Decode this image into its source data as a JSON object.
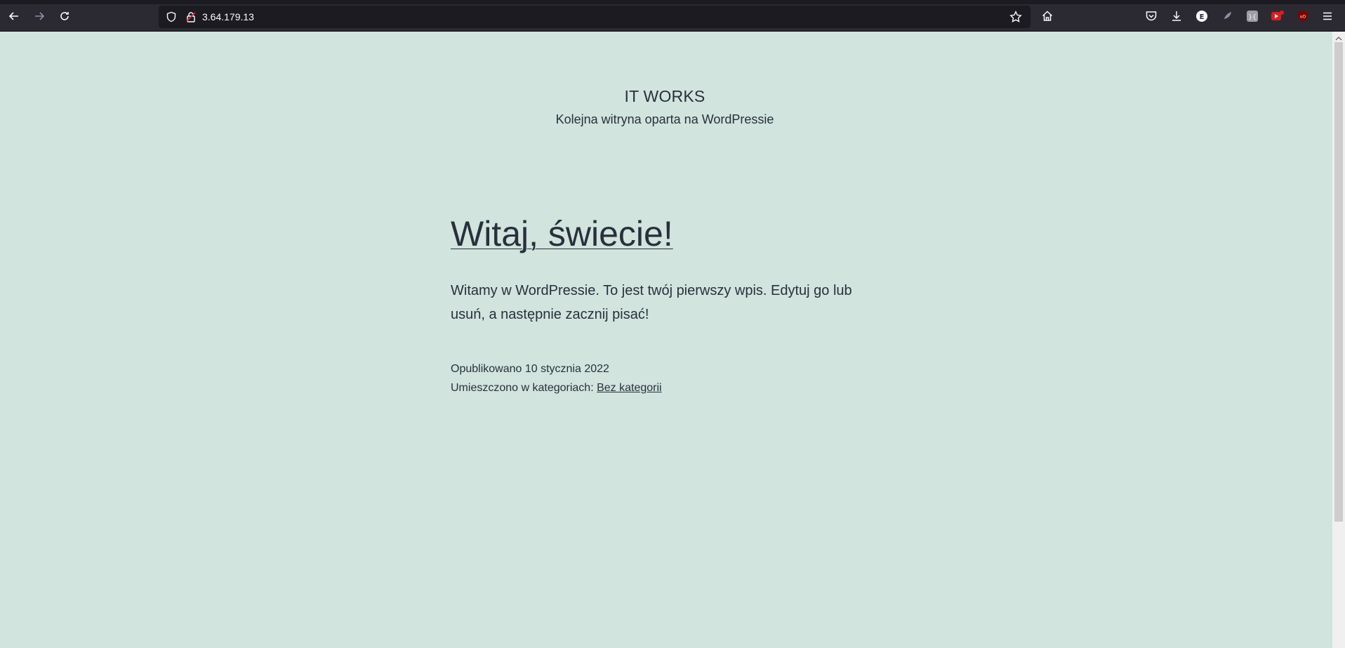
{
  "browser": {
    "url": "3.64.179.13",
    "icons": [
      "back-icon",
      "forward-icon",
      "reload-icon",
      "shield-icon",
      "lock-icon",
      "star-icon",
      "home-icon",
      "pocket-icon",
      "download-icon",
      "extension-e-icon",
      "extension-feather-icon",
      "extension-box-icon",
      "extension-red-icon",
      "ublock-icon",
      "menu-icon"
    ],
    "colors": {
      "toolbar": "#2b2a33",
      "urlbar": "#1c1b22",
      "page_bg": "#d1e4dd",
      "text": "#28303d"
    }
  },
  "site": {
    "title": "IT WORKS",
    "description": "Kolejna witryna oparta na WordPressie"
  },
  "post": {
    "title": "Witaj, świecie!",
    "body": "Witamy w WordPressie. To jest twój pierwszy wpis. Edytuj go lub usuń, a następnie zacznij pisać!",
    "published": "Opublikowano 10 stycznia 2022",
    "category_prefix": "Umieszczono w kategoriach:",
    "category": "Bez kategorii"
  }
}
